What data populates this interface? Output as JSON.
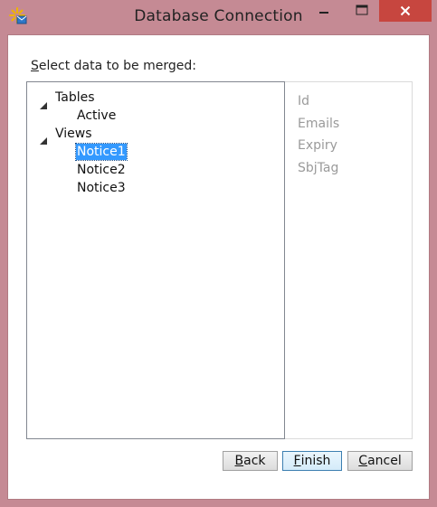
{
  "window": {
    "title": "Database Connection"
  },
  "prompt": {
    "accel": "S",
    "rest": "elect data to be merged:"
  },
  "tree": {
    "tables_label": "Tables",
    "tables_items": [
      "Active"
    ],
    "views_label": "Views",
    "views_items": [
      "Notice1",
      "Notice2",
      "Notice3"
    ],
    "selected": "Notice1"
  },
  "columns": [
    "Id",
    "Emails",
    "Expiry",
    "SbjTag"
  ],
  "buttons": {
    "back": {
      "accel": "B",
      "rest": "ack"
    },
    "finish": {
      "accel": "F",
      "rest": "inish"
    },
    "cancel": {
      "accel": "C",
      "rest": "ancel"
    }
  },
  "colors": {
    "frame": "#c58a94",
    "close": "#c7463f",
    "selection": "#3399ff"
  },
  "icons": [
    "app-sparkle-icon",
    "minimize-icon",
    "maximize-icon",
    "close-icon",
    "tree-expanded-icon"
  ]
}
